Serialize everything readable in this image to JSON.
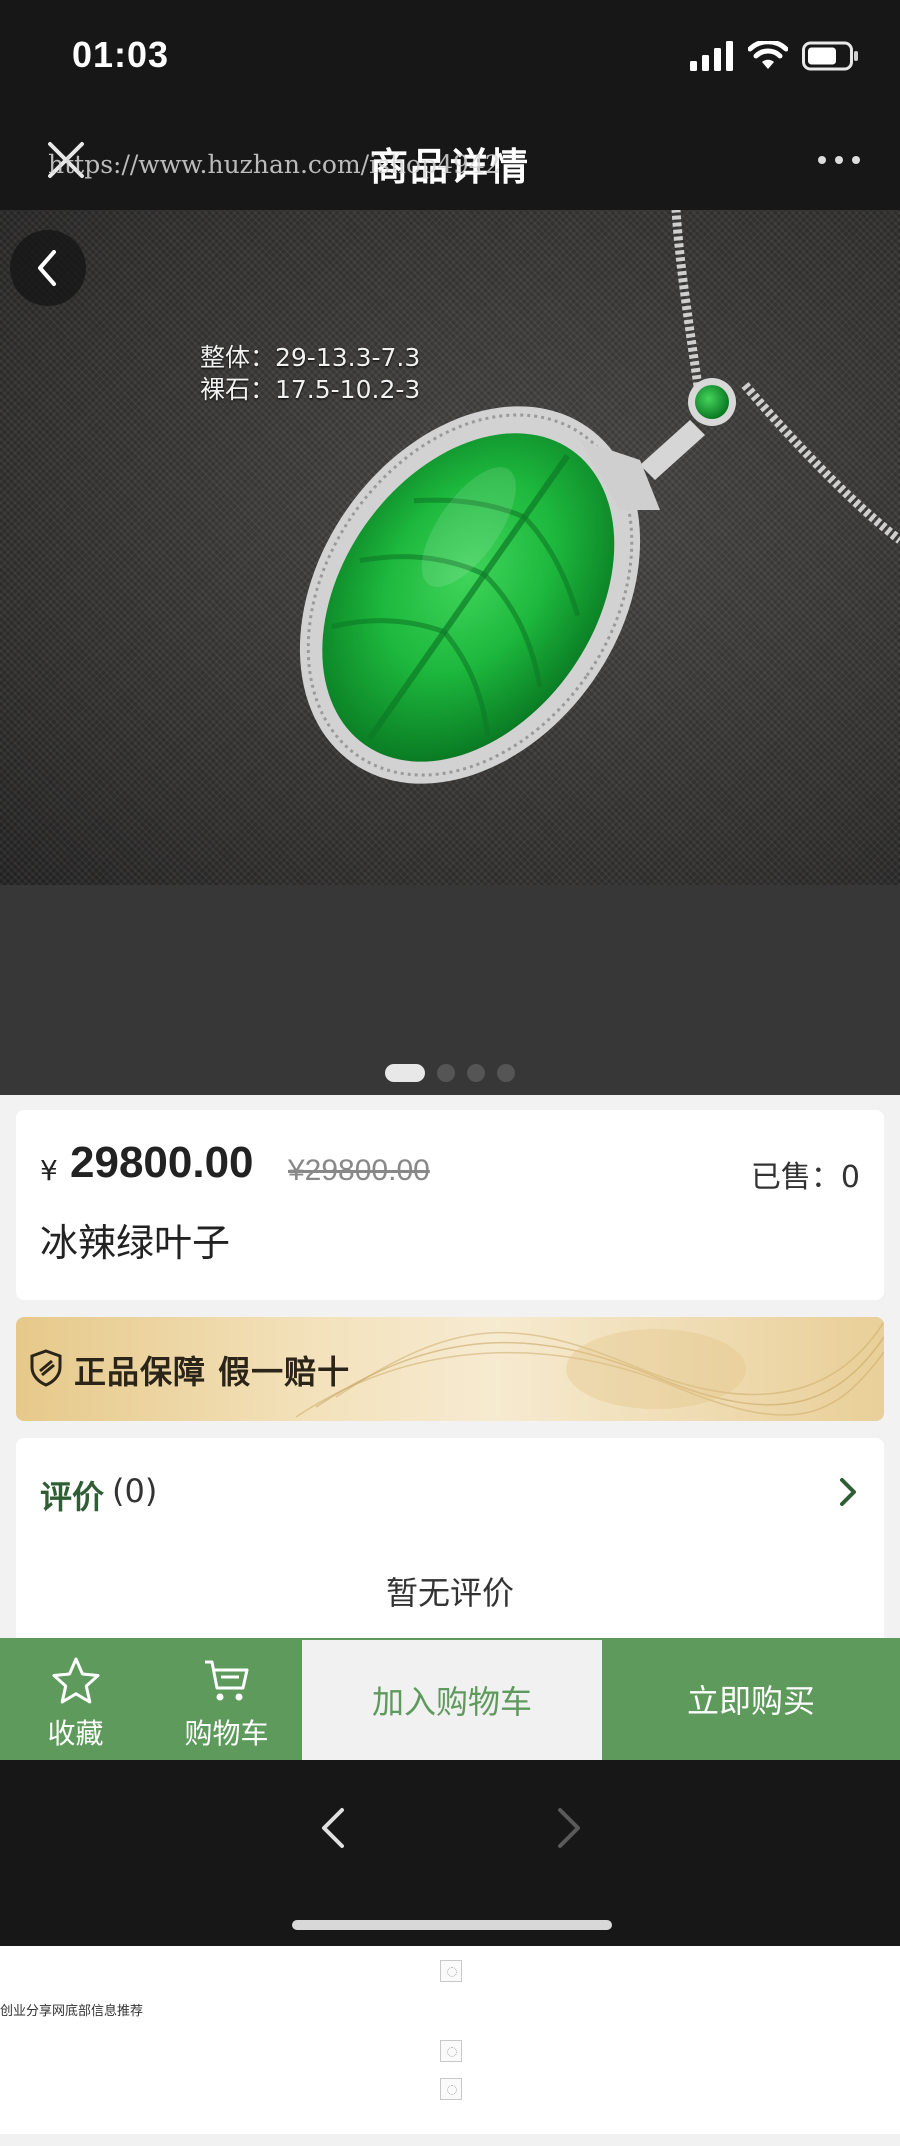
{
  "status_bar": {
    "time": "01:03"
  },
  "nav": {
    "title": "商品详情",
    "watermark_url": "https://www.huzhan.com/ishop4942"
  },
  "photo": {
    "spec_line1": "整体：29-13.3-7.3",
    "spec_line2": "裸石：17.5-10.2-3",
    "slide_count": 4,
    "active_slide": 1
  },
  "product": {
    "currency": "¥",
    "price": "29800.00",
    "original_price": "¥29800.00",
    "sold": "已售：0",
    "name": "冰辣绿叶子"
  },
  "guarantee": {
    "text": "正品保障 假一赔十"
  },
  "reviews": {
    "title": "评价",
    "count": "(0)",
    "empty_text": "暂无评价"
  },
  "actions": {
    "favorite": "收藏",
    "cart": "购物车",
    "add_to_cart": "加入购物车",
    "buy_now": "立即购买"
  },
  "footer": {
    "text": "创业分享网底部信息推荐"
  },
  "colors": {
    "brand_green": "#5f9a5d",
    "review_green": "#2f5e34",
    "dark_bar": "#171717"
  }
}
